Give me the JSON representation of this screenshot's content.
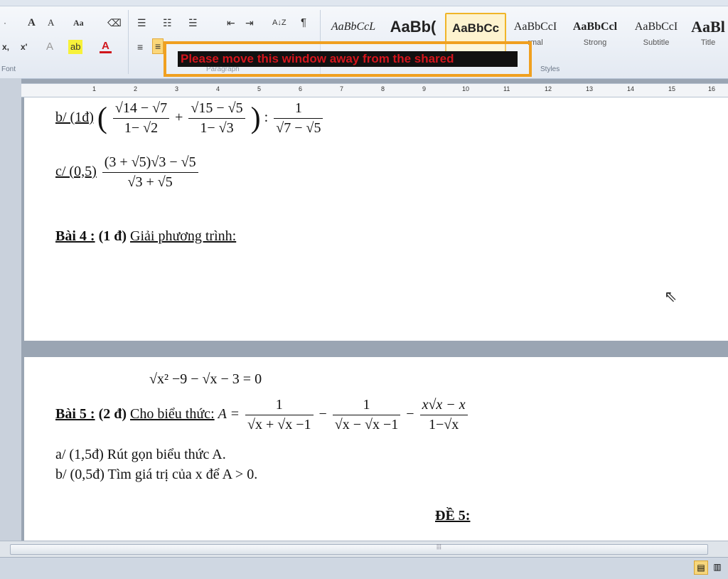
{
  "ribbon": {
    "font_row1": [
      "·",
      "A",
      "A",
      "Aa"
    ],
    "font_row2": [
      "x,",
      "x'"
    ],
    "group_font": "Font",
    "group_paragraph": "Paragraph",
    "group_styles": "Styles",
    "pilcrow": "¶",
    "sort": "A↓Z"
  },
  "styles": [
    {
      "sample": "AaBbCcL",
      "name": ""
    },
    {
      "sample": "AaBb(",
      "name": ""
    },
    {
      "sample": "AaBbCc",
      "name": "",
      "selected": true
    },
    {
      "sample": "AaBbCcI",
      "name": "rmal"
    },
    {
      "sample": "AaBbCcl",
      "name": "Strong"
    },
    {
      "sample": "AaBbCcI",
      "name": "Subtitle"
    },
    {
      "sample": "AaBl",
      "name": "Title"
    }
  ],
  "warning": {
    "text": "Please move this window away from the shared"
  },
  "ruler": {
    "numbers": [
      "1",
      "2",
      "3",
      "4",
      "5",
      "6",
      "7",
      "8",
      "9",
      "10",
      "11",
      "12",
      "13",
      "14",
      "15",
      "16"
    ]
  },
  "doc": {
    "b_label": "b/ (1đ)",
    "b_term1_num": "14 − √7",
    "b_term1_den": "1− √2",
    "b_plus": "+",
    "b_term2_num": "15 − √5",
    "b_term2_den": "1− √3",
    "b_colon": ":",
    "b_div_num": "1",
    "b_div_den": "√7 − √5",
    "c_label": "c/ (0,5)",
    "c_num": "(3 + √5)√3 − √5",
    "c_den": "√3 + √5",
    "bai4_title": "Bài 4 :",
    "bai4_points": "(1 đ)",
    "bai4_text": "Giải phương trình:",
    "eq_lhs": "√x² −9 − √x − 3 = 0",
    "bai5_title": "Bài 5 :",
    "bai5_points": "(2 đ)",
    "bai5_text": "Cho biểu thức:",
    "A_eq": "A =",
    "A_f1_num": "1",
    "A_f1_den": "√x + √x −1",
    "A_minus1": "−",
    "A_f2_num": "1",
    "A_f2_den": "√x − √x −1",
    "A_minus2": "−",
    "A_f3_num": "x√x − x",
    "A_f3_den": "1−√x",
    "a_line": "a/ (1,5đ) Rút gọn biểu thức A.",
    "b2_line": "b/ (0,5đ) Tìm giá trị của  x  để  A > 0.",
    "de5": "ĐỀ 5:"
  },
  "colors": {
    "warning_border": "#f0a020",
    "warning_text": "#d4141c",
    "style_selected": "#f0b528"
  }
}
